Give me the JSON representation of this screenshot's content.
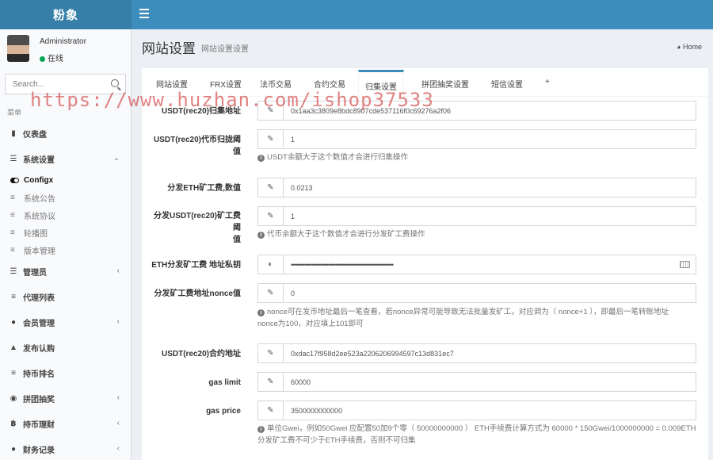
{
  "brand": "粉象",
  "user": {
    "name": "Administrator",
    "status": "在线"
  },
  "search": {
    "placeholder": "Search..."
  },
  "menu_header": "菜单",
  "menu": [
    {
      "label": "仪表盘",
      "icon": "bar-chart-icon"
    },
    {
      "label": "系统设置",
      "icon": "sliders-icon",
      "arrow": "chevron-down-icon"
    },
    {
      "label": "管理员",
      "icon": "list-icon",
      "arrow": "chevron-left-icon"
    },
    {
      "label": "代理列表",
      "icon": "list-icon"
    },
    {
      "label": "会员管理",
      "icon": "users-icon",
      "arrow": "chevron-left-icon"
    },
    {
      "label": "发布认购",
      "icon": "cart-icon"
    },
    {
      "label": "持币排名",
      "icon": "list-icon"
    },
    {
      "label": "拼团抽奖",
      "icon": "gamepad-icon",
      "arrow": "chevron-left-icon"
    },
    {
      "label": "持币理财",
      "icon": "bitcoin-icon",
      "arrow": "chevron-left-icon"
    },
    {
      "label": "财务记录",
      "icon": "coins-icon",
      "arrow": "chevron-left-icon"
    }
  ],
  "submenu": [
    {
      "label": "Configx",
      "active": true
    },
    {
      "label": "系统公告"
    },
    {
      "label": "系统协议"
    },
    {
      "label": "轮播图"
    },
    {
      "label": "版本管理"
    }
  ],
  "page": {
    "title": "网站设置",
    "subtitle": "网站设置设置",
    "breadcrumb": "Home"
  },
  "tabs": [
    "网站设置",
    "FRX设置",
    "法币交易",
    "合约交易",
    "归集设置",
    "拼团抽奖设置",
    "短信设置",
    "+"
  ],
  "active_tab": "归集设置",
  "fields": [
    {
      "label": "USDT(rec20)归集地址",
      "value": "0x1aa3c3809e8bdc8907cde537116f0c69276a2f06",
      "icon": "pencil-icon"
    },
    {
      "label": "USDT(rec20)代币归拢阈值",
      "value": "1",
      "icon": "pencil-icon",
      "help": "USDT余额大于这个数值才会进行归集操作"
    },
    {
      "label": "分发ETH矿工费,数值",
      "value": "0.0213",
      "icon": "pencil-icon"
    },
    {
      "label_lines": [
        "分发USDT(rec20)矿工费阈",
        "值"
      ],
      "value": "1",
      "icon": "pencil-icon",
      "help": "代币余额大于这个数值才会进行分发矿工费操作"
    },
    {
      "label": "ETH分发矿工费 地址私钥",
      "value": "••••••••••••••••••••••••••••••••••••••••••••••••••••••••••••",
      "icon": "eye-slash-icon",
      "keyboard": true
    },
    {
      "label": "分发矿工费地址nonce值",
      "value": "0",
      "icon": "pencil-icon",
      "help_lines": [
        "nonce可在发币地址最后一笔查看，若nonce异常可能导致无法批量发矿工，对应调为（ nonce+1 ），即最后一笔转账地址",
        "nonce为100，对应填上101即可"
      ]
    },
    {
      "label": "USDT(rec20)合约地址",
      "value": "0xdac17f958d2ee523a2206206994597c13d831ec7",
      "icon": "pencil-icon"
    },
    {
      "label": "gas limit",
      "value": "60000",
      "icon": "pencil-icon"
    },
    {
      "label": "gas price",
      "value": "3500000000000",
      "icon": "pencil-icon",
      "help_lines": [
        "单位Gwei，例如50Gwei 应配置50加9个零（ 50000000000 ） ETH手续费计算方式为 60000 * 150Gwei/1000000000 = 0.009ETH",
        "分发矿工费不可少于ETH手续费，否则不可归集"
      ]
    }
  ],
  "watermark": "https://www.huzhan.com/ishop37533"
}
